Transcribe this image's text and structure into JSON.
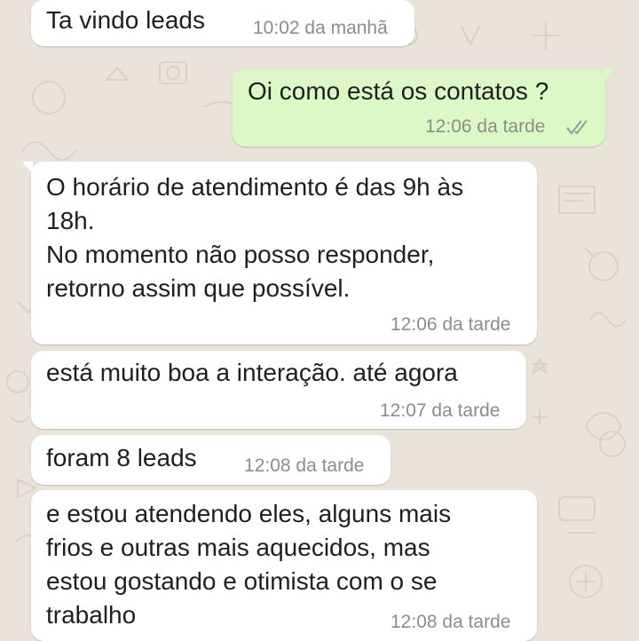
{
  "colors": {
    "incoming_bubble": "#ffffff",
    "outgoing_bubble": "#dcf8c6",
    "wallpaper": "#e9e3da",
    "timestamp": "#8c8c8c",
    "read_ticks": "#9a9a9a"
  },
  "messages": [
    {
      "direction": "incoming",
      "text": "Ta vindo leads",
      "time": "10:02 da manhã"
    },
    {
      "direction": "outgoing",
      "text": "Oi como está os contatos ?",
      "time": "12:06 da tarde",
      "status_icon": "double-check-icon"
    },
    {
      "direction": "incoming",
      "text": "O horário de atendimento é das 9h às\n18h.\nNo momento não posso responder,\nretorno assim que possível.",
      "time": "12:06 da tarde"
    },
    {
      "direction": "incoming",
      "text": "está muito boa a interação. até agora",
      "time": "12:07 da tarde"
    },
    {
      "direction": "incoming",
      "text": "foram 8 leads",
      "time": "12:08 da tarde"
    },
    {
      "direction": "incoming",
      "text": "e estou atendendo eles, alguns mais\nfrios e outras mais aquecidos, mas\nestou gostando e otimista com o se\ntrabalho",
      "time": "12:08 da tarde"
    }
  ]
}
